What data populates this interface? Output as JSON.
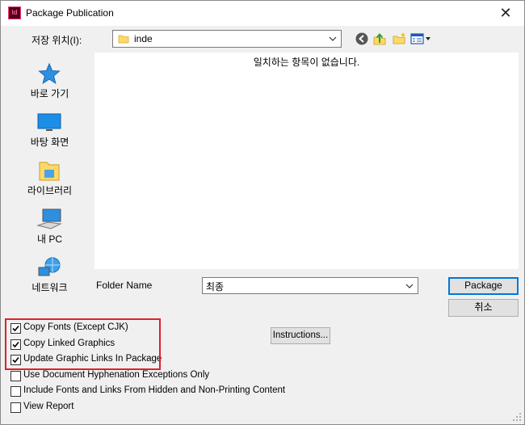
{
  "window": {
    "title": "Package Publication",
    "app_icon_text": "Id",
    "close_glyph": "✕"
  },
  "look_in": {
    "label": "저장 위치(I):",
    "value": "inde"
  },
  "places": [
    {
      "label": "바로 가기",
      "icon": "star-quick-access-icon"
    },
    {
      "label": "바탕 화면",
      "icon": "desktop-icon"
    },
    {
      "label": "라이브러리",
      "icon": "library-folder-icon"
    },
    {
      "label": "내 PC",
      "icon": "computer-icon"
    },
    {
      "label": "네트워크",
      "icon": "network-icon"
    }
  ],
  "file_list": {
    "empty_message": "일치하는 항목이 없습니다."
  },
  "folder_name": {
    "label": "Folder Name",
    "value": "최종"
  },
  "buttons": {
    "package": "Package",
    "cancel": "취소",
    "instructions": "Instructions..."
  },
  "options": [
    {
      "label": "Copy Fonts (Except CJK)",
      "checked": true
    },
    {
      "label": "Copy Linked Graphics",
      "checked": true
    },
    {
      "label": "Update Graphic Links In Package",
      "checked": true
    },
    {
      "label": "Use Document Hyphenation Exceptions Only",
      "checked": false
    },
    {
      "label": "Include Fonts and Links From Hidden and Non-Printing Content",
      "checked": false
    },
    {
      "label": "View Report",
      "checked": false
    }
  ],
  "colors": {
    "accent": "#0078d7",
    "highlight": "#e0202a",
    "folder": "#ffd966"
  }
}
